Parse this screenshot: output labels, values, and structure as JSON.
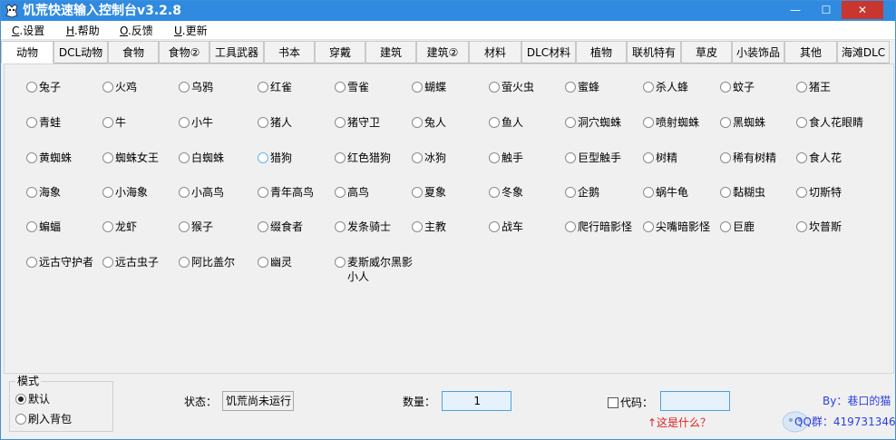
{
  "window": {
    "title": "饥荒快速输入控制台v3.2.8",
    "controls": {
      "minimize": "—",
      "maximize": "☐",
      "close": "✕"
    }
  },
  "menu": [
    {
      "accel": "C",
      "label": ".设置"
    },
    {
      "accel": "H",
      "label": ".帮助"
    },
    {
      "accel": "O",
      "label": ".反馈"
    },
    {
      "accel": "U",
      "label": ".更新"
    }
  ],
  "tabs": [
    "动物",
    "DCL动物",
    "食物",
    "食物②",
    "工具武器",
    "书本",
    "穿戴",
    "建筑",
    "建筑②",
    "材料",
    "DLC材料",
    "植物",
    "联机特有",
    "草皮",
    "小装饰品",
    "其他",
    "海滩DLC"
  ],
  "active_tab": "动物",
  "animals": [
    [
      "兔子",
      "火鸡",
      "乌鸦",
      "红雀",
      "雪雀",
      "蝴蝶",
      "萤火虫",
      "蜜蜂",
      "杀人蜂",
      "蚊子",
      "猪王"
    ],
    [
      "青蛙",
      "牛",
      "小牛",
      "猪人",
      "猪守卫",
      "兔人",
      "鱼人",
      "洞穴蜘蛛",
      "喷射蜘蛛",
      "黑蜘蛛",
      "食人花眼睛"
    ],
    [
      "黄蜘蛛",
      "蜘蛛女王",
      "白蜘蛛",
      "猎狗",
      "红色猎狗",
      "冰狗",
      "触手",
      "巨型触手",
      "树精",
      "稀有树精",
      "食人花"
    ],
    [
      "海象",
      "小海象",
      "小高鸟",
      "青年高鸟",
      "高鸟",
      "夏象",
      "冬象",
      "企鹅",
      "蜗牛龟",
      "黏糊虫",
      "切斯特"
    ],
    [
      "蝙蝠",
      "龙虾",
      "猴子",
      "缀食者",
      "发条骑士",
      "主教",
      "战车",
      "爬行暗影怪",
      "尖嘴暗影怪",
      "巨鹿",
      "坎普斯"
    ],
    [
      "远古守护者",
      "远古虫子",
      "阿比盖尔",
      "幽灵",
      "麦斯威尔黑影小人"
    ]
  ],
  "mode": {
    "legend": "模式",
    "options": [
      "默认",
      "刷入背包"
    ],
    "selected": "默认"
  },
  "status": {
    "label": "状态：",
    "value": "饥荒尚未运行"
  },
  "quantity": {
    "label": "数量：",
    "value": "1"
  },
  "code": {
    "label": "代码：",
    "value": "",
    "checked": false
  },
  "help_link": "↑这是什么？",
  "author": "By：巷口的猫",
  "qq": "QQ群：419731346",
  "colors": {
    "titlebar": "#2f8ae0",
    "close_button": "#c7372f",
    "link_red": "#e02020",
    "author_blue": "#2a3fe0"
  }
}
